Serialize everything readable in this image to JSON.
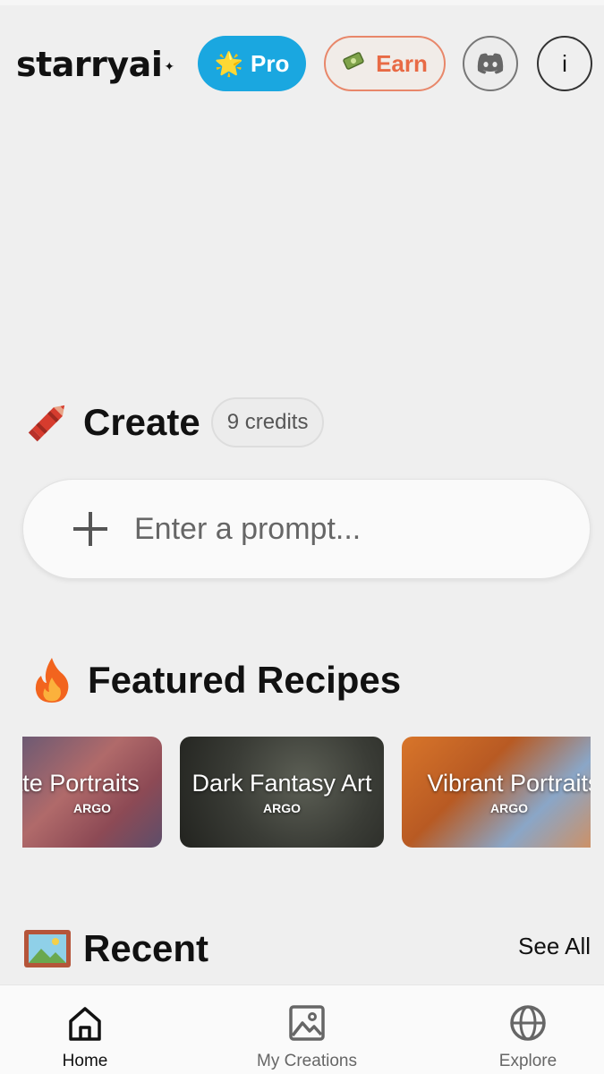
{
  "header": {
    "logo": "starryai",
    "pro_label": "Pro",
    "earn_label": "Earn",
    "pro_color": "#1aa7e0",
    "earn_color": "#e86a45"
  },
  "create": {
    "title": "Create",
    "credits": "9 credits",
    "prompt_placeholder": "Enter a prompt..."
  },
  "featured": {
    "title": "Featured Recipes",
    "recipes": [
      {
        "title": "ate Portraits",
        "tag": "ARGO"
      },
      {
        "title": "Dark Fantasy Art",
        "tag": "ARGO"
      },
      {
        "title": "Vibrant Portraits",
        "tag": "ARGO"
      }
    ]
  },
  "recent": {
    "title": "Recent",
    "see_all": "See All"
  },
  "nav": {
    "items": [
      {
        "label": "Home",
        "icon": "home-icon",
        "active": true
      },
      {
        "label": "My Creations",
        "icon": "image-icon",
        "active": false
      },
      {
        "label": "Explore",
        "icon": "globe-icon",
        "active": false
      }
    ]
  }
}
